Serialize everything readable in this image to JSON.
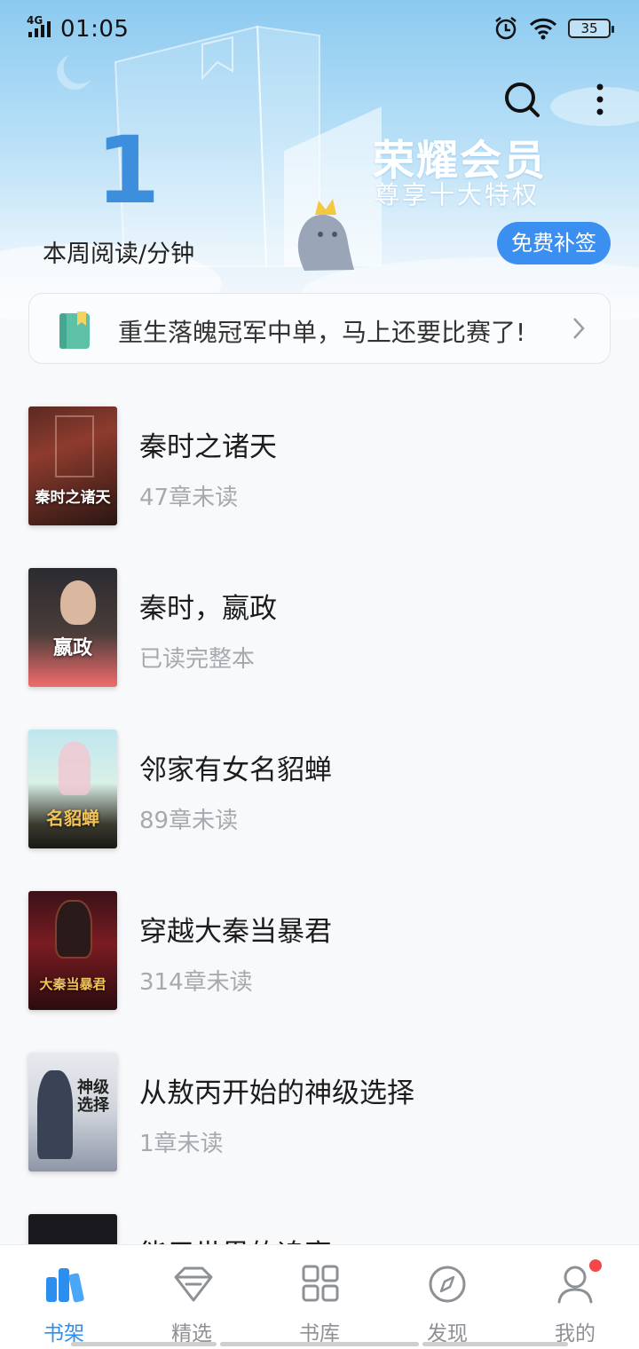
{
  "status_bar": {
    "network": "4G",
    "time": "01:05",
    "battery": "35"
  },
  "header": {
    "reading_minutes": "1",
    "reading_label": "本周阅读/分钟",
    "vip_title": "荣耀会员",
    "vip_subtitle": "尊享十大特权",
    "signin_button": "免费补签"
  },
  "notice": {
    "text": "重生落魄冠军中单，马上还要比赛了!"
  },
  "books": [
    {
      "title": "秦时之诸天",
      "status": "47章未读",
      "cover_text": "秦时之诸天"
    },
    {
      "title": "秦时，嬴政",
      "status": "已读完整本",
      "cover_text": "嬴政"
    },
    {
      "title": "邻家有女名貂蝉",
      "status": "89章未读",
      "cover_text": "名貂蝉"
    },
    {
      "title": "穿越大秦当暴君",
      "status": "314章未读",
      "cover_text": "大秦当暴君"
    },
    {
      "title": "从敖丙开始的神级选择",
      "status": "1章未读",
      "cover_text": "神级选择"
    },
    {
      "title": "能用世界的追寄",
      "status": ""
    }
  ],
  "bottom_nav": {
    "items": [
      {
        "label": "书架",
        "icon": "bookshelf-icon",
        "active": true
      },
      {
        "label": "精选",
        "icon": "diamond-icon",
        "active": false
      },
      {
        "label": "书库",
        "icon": "grid-icon",
        "active": false
      },
      {
        "label": "发现",
        "icon": "compass-icon",
        "active": false
      },
      {
        "label": "我的",
        "icon": "user-icon",
        "active": false
      }
    ]
  },
  "colors": {
    "accent": "#2c8ff0",
    "reading_number": "#3d8fdd",
    "badge": "#f24848"
  }
}
